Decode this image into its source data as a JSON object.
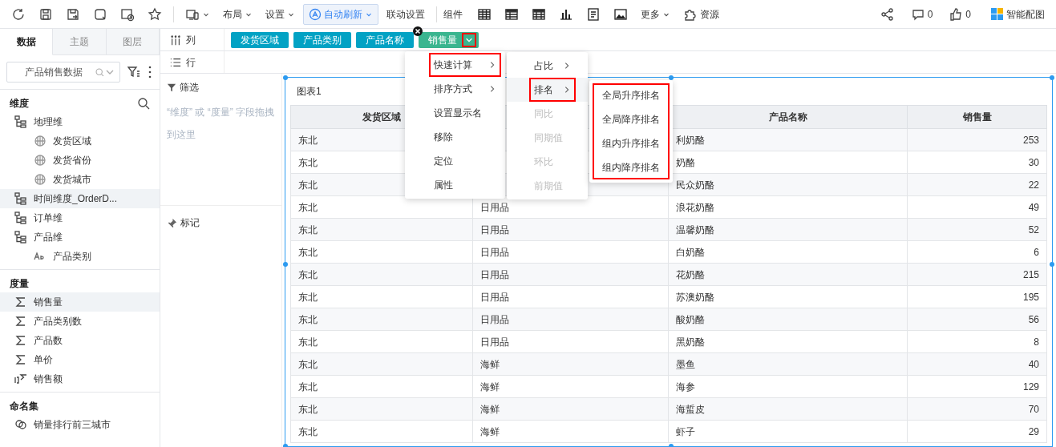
{
  "toolbar": {
    "items": [
      {
        "kind": "device",
        "dropdown": true,
        "active": false
      },
      {
        "kind": "text",
        "label": "布局",
        "dropdown": true,
        "active": false
      },
      {
        "kind": "text",
        "label": "设置",
        "dropdown": true,
        "active": false
      },
      {
        "kind": "auto",
        "label": "自动刷新",
        "dropdown": true,
        "active": true
      },
      {
        "kind": "text",
        "label": "联动设置",
        "dropdown": false,
        "active": false
      }
    ],
    "components_label": "组件",
    "more": "更多",
    "resources": "资源",
    "comments": "0",
    "likes": "0",
    "smart": "智能配图"
  },
  "left_panel": {
    "tabs": [
      {
        "label": "数据",
        "selected": true
      },
      {
        "label": "主题",
        "selected": false
      },
      {
        "label": "图层",
        "selected": false
      }
    ],
    "dataset": "产品销售数据",
    "sections": [
      {
        "title": "维度",
        "search": true,
        "items": [
          {
            "kind": "hierarchy",
            "label": "地理维",
            "selected": false,
            "children": [
              {
                "kind": "geo",
                "label": "发货区域",
                "selected": false
              },
              {
                "kind": "geo",
                "label": "发货省份",
                "selected": false
              },
              {
                "kind": "geo",
                "label": "发货城市",
                "selected": false
              }
            ]
          },
          {
            "kind": "hierarchy",
            "label": "时间维度_OrderD...",
            "selected": true
          },
          {
            "kind": "hierarchy",
            "label": "订单维",
            "selected": false
          },
          {
            "kind": "hierarchy",
            "label": "产品维",
            "selected": false,
            "children": [
              {
                "kind": "text",
                "label": "产品类别",
                "selected": false
              }
            ]
          }
        ]
      },
      {
        "title": "度量",
        "search": false,
        "items": [
          {
            "kind": "measure",
            "label": "销售量",
            "selected": true
          },
          {
            "kind": "measure",
            "label": "产品类别数",
            "selected": false
          },
          {
            "kind": "measure",
            "label": "产品数",
            "selected": false
          },
          {
            "kind": "measure",
            "label": "单价",
            "selected": false
          },
          {
            "kind": "calc",
            "label": "销售额",
            "selected": false
          }
        ]
      },
      {
        "title": "命名集",
        "search": false,
        "items": [
          {
            "kind": "set",
            "label": "销量排行前三城市",
            "selected": false
          }
        ]
      }
    ]
  },
  "shelves": [
    {
      "label": "列",
      "pills": [
        {
          "label": "发货区域",
          "kind": "dimension",
          "highlighted": false
        },
        {
          "label": "产品类别",
          "kind": "dimension",
          "highlighted": false
        },
        {
          "label": "产品名称",
          "kind": "dimension",
          "highlighted": false
        },
        {
          "label": "销售量",
          "kind": "measure",
          "highlighted": true
        }
      ]
    },
    {
      "label": "行"
    }
  ],
  "filter": {
    "label": "筛选",
    "placeholder": "“维度” 或 “度量” 字段拖拽到这里"
  },
  "marks": {
    "label": "标记"
  },
  "chart": {
    "title": "图表1",
    "columns": [
      {
        "label": "发货区域",
        "kind": "text"
      },
      {
        "kind": "text"
      },
      {
        "label": "产品名称",
        "kind": "text"
      },
      {
        "label": "销售量",
        "kind": "number"
      }
    ],
    "rows": [
      [
        "东北",
        "",
        "利奶酪",
        "253"
      ],
      [
        "东北",
        "",
        "奶酪",
        "30"
      ],
      [
        "东北",
        "",
        "民众奶酪",
        "22"
      ],
      [
        "东北",
        "日用品",
        "浪花奶酪",
        "49"
      ],
      [
        "东北",
        "日用品",
        "温馨奶酪",
        "52"
      ],
      [
        "东北",
        "日用品",
        "白奶酪",
        "6"
      ],
      [
        "东北",
        "日用品",
        "花奶酪",
        "215"
      ],
      [
        "东北",
        "日用品",
        "苏澳奶酪",
        "195"
      ],
      [
        "东北",
        "日用品",
        "酸奶酪",
        "56"
      ],
      [
        "东北",
        "日用品",
        "黑奶酪",
        "8"
      ],
      [
        "东北",
        "海鲜",
        "墨鱼",
        "40"
      ],
      [
        "东北",
        "海鲜",
        "海参",
        "129"
      ],
      [
        "东北",
        "海鲜",
        "海蜇皮",
        "70"
      ],
      [
        "东北",
        "海鲜",
        "虾子",
        "29"
      ]
    ]
  },
  "menus": [
    {
      "items": [
        {
          "label": "快速计算",
          "submenu": true,
          "highlighted": true,
          "disabled": false
        },
        {
          "label": "排序方式",
          "submenu": true,
          "highlighted": false,
          "disabled": false
        },
        {
          "label": "设置显示名",
          "submenu": false,
          "highlighted": false,
          "disabled": false
        },
        {
          "label": "移除",
          "submenu": false,
          "highlighted": false,
          "disabled": false
        },
        {
          "label": "定位",
          "submenu": false,
          "highlighted": false,
          "disabled": false
        },
        {
          "label": "属性",
          "submenu": false,
          "highlighted": false,
          "disabled": false
        }
      ]
    },
    {
      "items": [
        {
          "label": "占比",
          "submenu": true,
          "highlighted": false,
          "disabled": false
        },
        {
          "label": "排名",
          "submenu": true,
          "highlighted": true,
          "disabled": false
        },
        {
          "label": "同比",
          "submenu": false,
          "highlighted": false,
          "disabled": true
        },
        {
          "label": "同期值",
          "submenu": false,
          "highlighted": false,
          "disabled": true
        },
        {
          "label": "环比",
          "submenu": false,
          "highlighted": false,
          "disabled": true
        },
        {
          "label": "前期值",
          "submenu": false,
          "highlighted": false,
          "disabled": true
        }
      ]
    },
    {
      "highlighted": true,
      "items": [
        {
          "label": "全局升序排名",
          "submenu": false,
          "highlighted": false,
          "disabled": false
        },
        {
          "label": "全局降序排名",
          "submenu": false,
          "highlighted": false,
          "disabled": false
        },
        {
          "label": "组内升序排名",
          "submenu": false,
          "highlighted": false,
          "disabled": false
        },
        {
          "label": "组内降序排名",
          "submenu": false,
          "highlighted": false,
          "disabled": false
        }
      ]
    }
  ]
}
